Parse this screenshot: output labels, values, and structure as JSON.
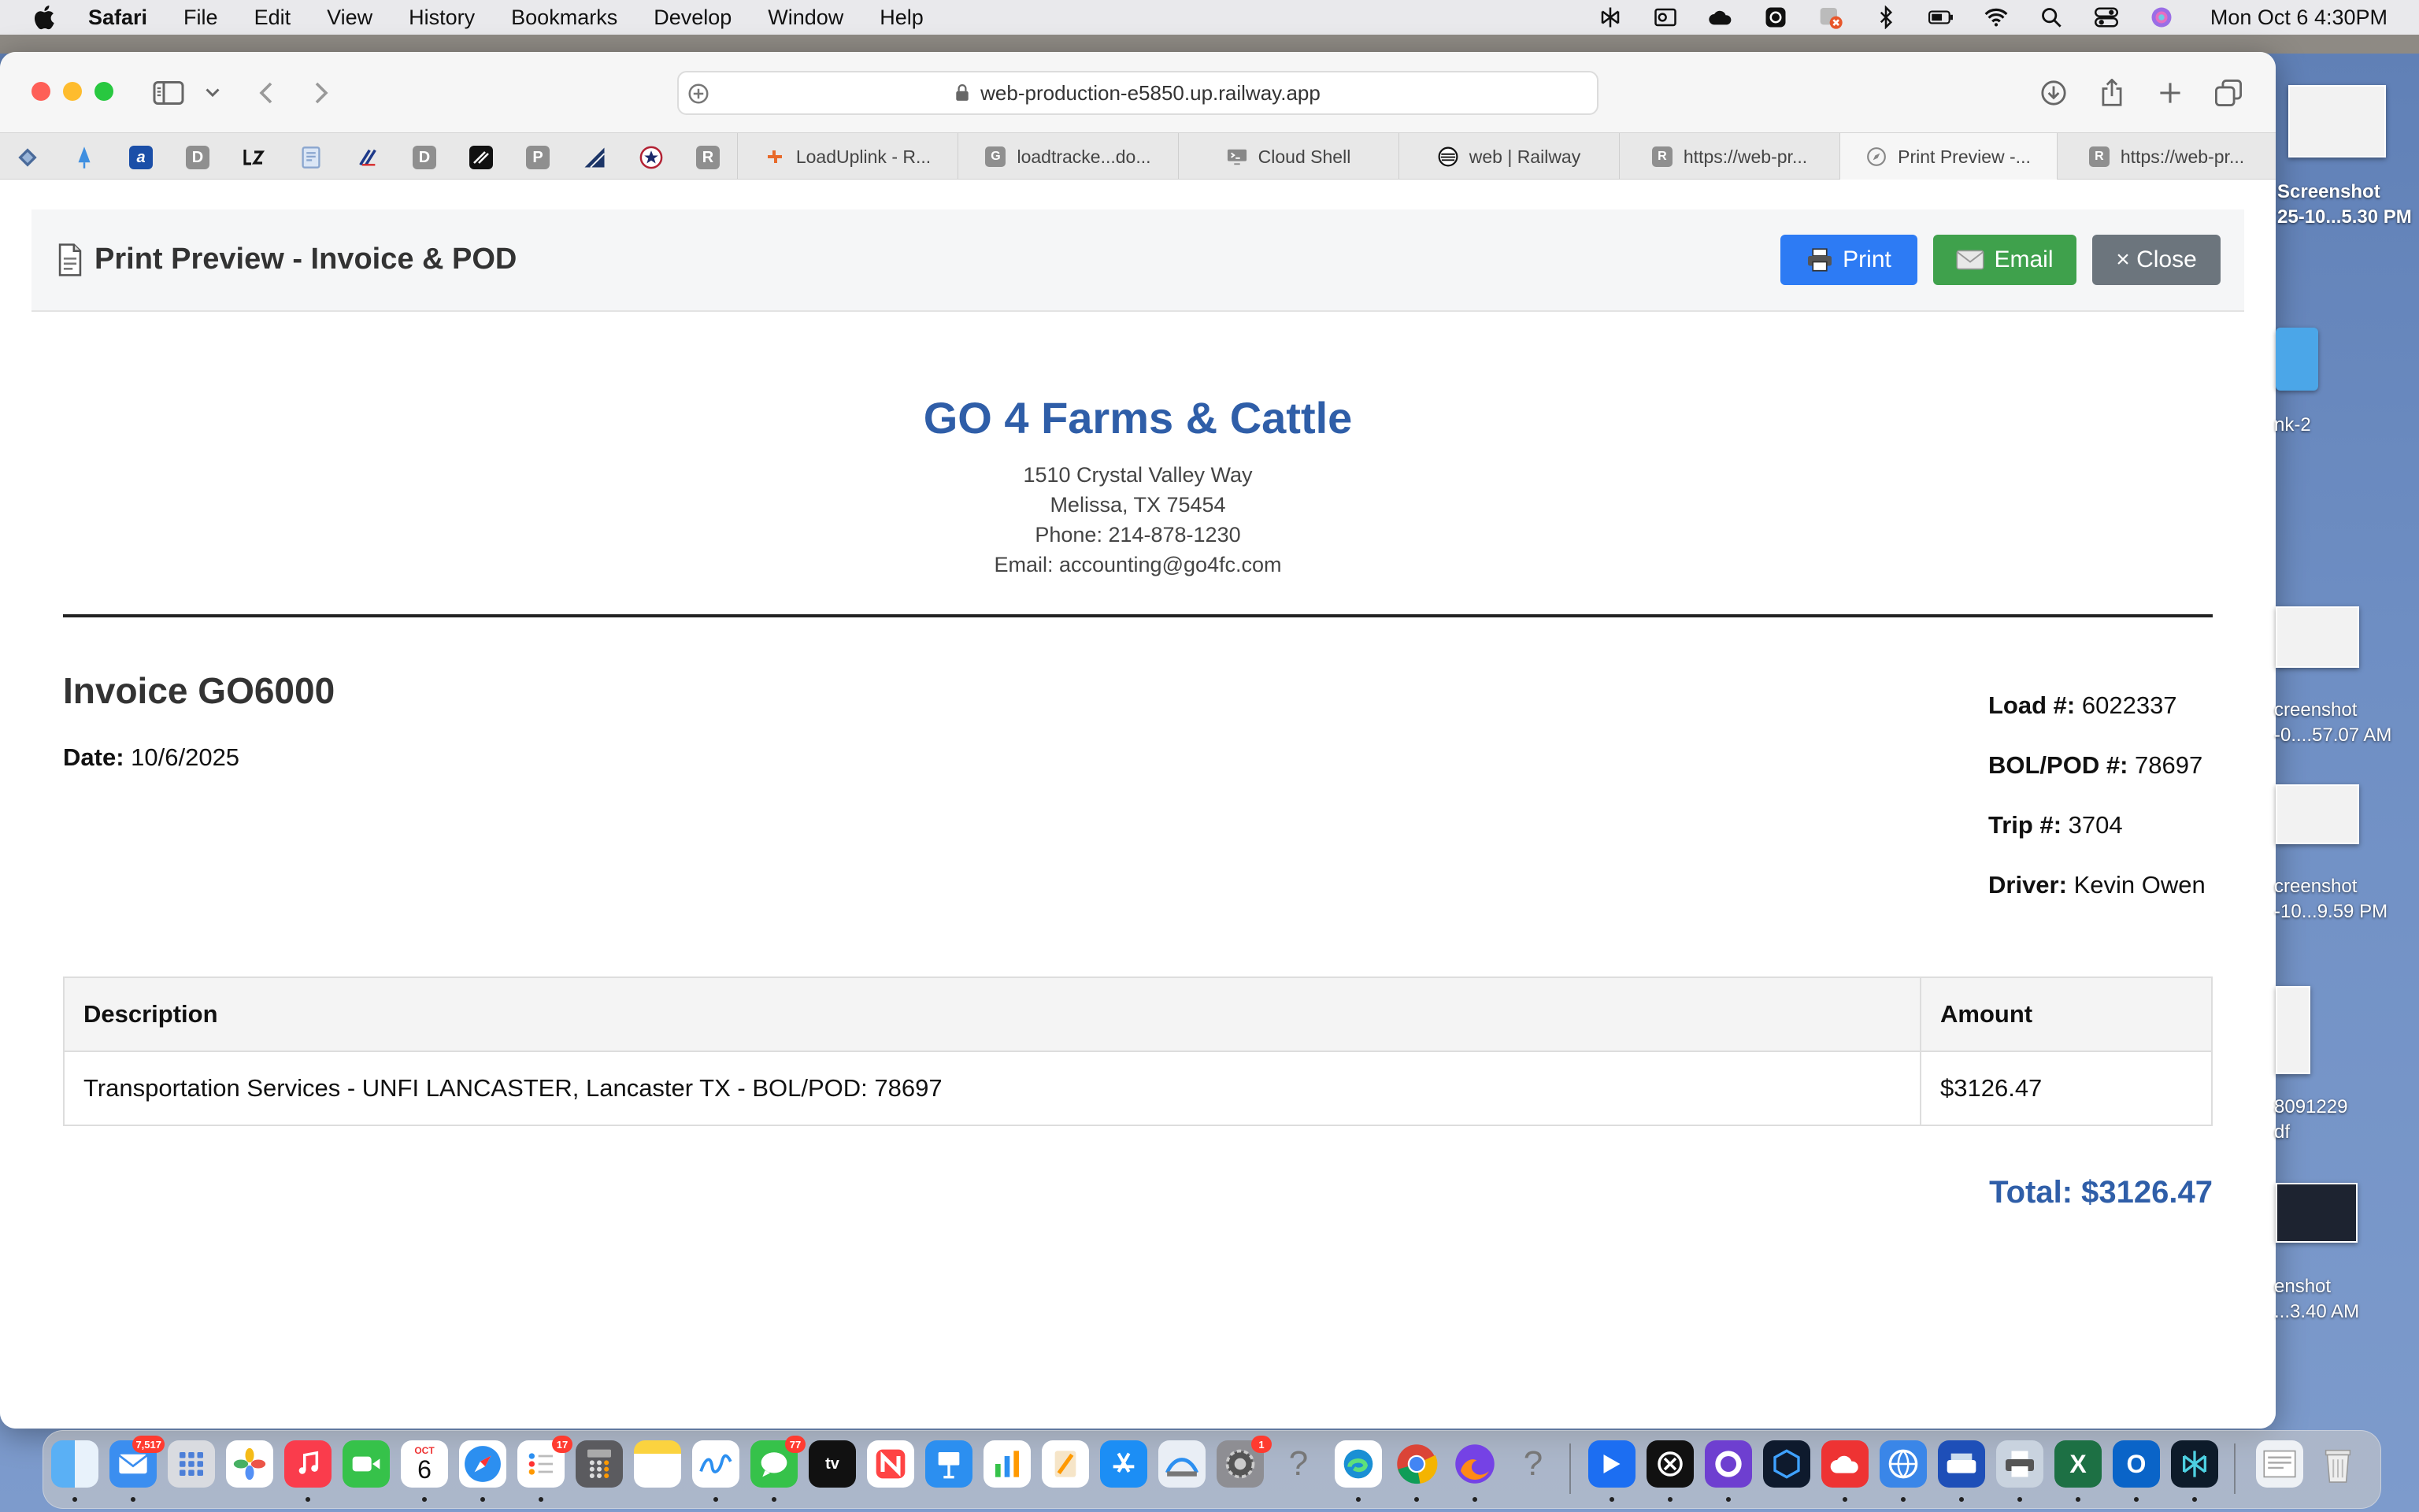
{
  "menubar": {
    "app": "Safari",
    "items": [
      "File",
      "Edit",
      "View",
      "History",
      "Bookmarks",
      "Develop",
      "Window",
      "Help"
    ],
    "clock": "Mon Oct 6  4:30PM"
  },
  "browser": {
    "url": "web-production-e5850.up.railway.app",
    "pinned_tabs": [
      "D",
      "D",
      "P",
      "R"
    ],
    "tabs": [
      {
        "label": "LoadUplink - R..."
      },
      {
        "label": "loadtracke...do..."
      },
      {
        "label": "Cloud Shell"
      },
      {
        "label": "web | Railway"
      },
      {
        "label": "https://web-pr..."
      },
      {
        "label": "Print Preview -...",
        "active": true
      },
      {
        "label": "https://web-pr..."
      }
    ],
    "tab_fav_letters": {
      "loadtracker": "G",
      "https1": "R",
      "https2": "R"
    }
  },
  "preview": {
    "title": "Print Preview - Invoice & POD",
    "print_label": "Print",
    "email_label": "Email",
    "close_label": "× Close"
  },
  "company": {
    "name": "GO 4 Farms & Cattle",
    "address1": "1510 Crystal Valley Way",
    "address2": "Melissa, TX 75454",
    "phone": "Phone: 214-878-1230",
    "email": "Email: accounting@go4fc.com"
  },
  "invoice": {
    "title": "Invoice GO6000",
    "date_label": "Date:",
    "date": "10/6/2025",
    "load_label": "Load #:",
    "load": "6022337",
    "bol_label": "BOL/POD #:",
    "bol": "78697",
    "trip_label": "Trip #:",
    "trip": "3704",
    "driver_label": "Driver:",
    "driver": "Kevin Owen",
    "columns": [
      "Description",
      "Amount"
    ],
    "rows": [
      {
        "description": "Transportation Services - UNFI LANCASTER, Lancaster TX - BOL/POD: 78697",
        "amount": "$3126.47"
      }
    ],
    "total": "Total: $3126.47"
  },
  "desktop": {
    "items": [
      {
        "line1": "Screenshot",
        "line2": "25-10...5.30 PM"
      },
      {
        "line1": "nk-2",
        "line2": ""
      },
      {
        "line1": "creenshot",
        "line2": "-0....57.07 AM"
      },
      {
        "line1": "creenshot",
        "line2": "-10...9.59 PM"
      },
      {
        "line1": "8091229",
        "line2": "df"
      },
      {
        "line1": "enshot",
        "line2": "...3.40 AM"
      }
    ]
  },
  "dock": {
    "mail_badge": "7,517",
    "calendar_month": "OCT",
    "calendar_day": "6",
    "reminders_badge": "17",
    "messages_badge": "77",
    "settings_badge": "1"
  },
  "colors": {
    "accent_blue": "#2f5ea8",
    "print_button": "#2d7bf4",
    "email_button": "#3fa14c",
    "close_button": "#6c757d"
  }
}
